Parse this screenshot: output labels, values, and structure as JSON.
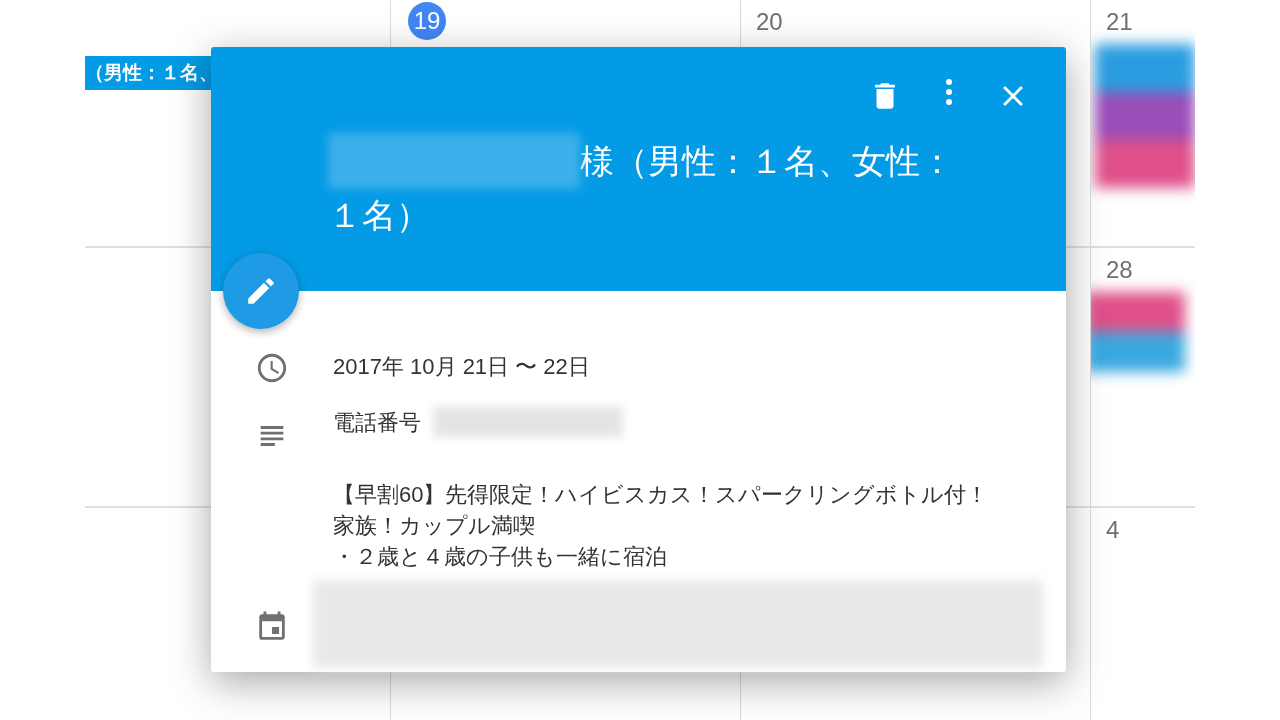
{
  "calendar": {
    "weeks": [
      {
        "days": [
          {
            "events": [
              {
                "kind": "chip",
                "label": "（男性：１名、",
                "color": "#039be5"
              }
            ]
          },
          {
            "date": "19",
            "today": true
          },
          {
            "date": "20",
            "today": false
          },
          {
            "date": "21",
            "today": false,
            "events": [
              {
                "kind": "blurred",
                "color": "#2a9de0"
              },
              {
                "kind": "blurred",
                "color": "#9b4db8"
              },
              {
                "kind": "blurred",
                "color": "#e0508a"
              }
            ]
          }
        ]
      },
      {
        "days": [
          {
            "date": "28",
            "today": false,
            "events": [
              {
                "kind": "blurred",
                "color": "#e0508a"
              },
              {
                "kind": "blurred",
                "color": "#3aa8e0"
              }
            ]
          }
        ]
      },
      {
        "days": [
          {
            "date": "4",
            "today": false
          }
        ]
      }
    ]
  },
  "dialog": {
    "title": {
      "lines": [
        "様（男性：１名、女性：",
        "１名）"
      ],
      "redacted_lead": true
    },
    "rows": [
      {
        "kind": "time",
        "text": "2017年 10月 21日 〜 22日"
      },
      {
        "kind": "phone",
        "label": "電話番号",
        "value_redacted": true
      },
      {
        "kind": "description",
        "lines": [
          "【早割60】先得限定！ハイビスカス！スパークリングボトル付！家族！カップル満喫",
          "・２歳と４歳の子供も一緒に宿泊"
        ]
      },
      {
        "kind": "calendar",
        "redacted": true
      }
    ]
  }
}
